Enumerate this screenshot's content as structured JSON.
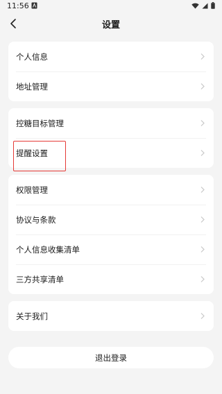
{
  "status_bar": {
    "time": "11:56",
    "icons": [
      "notification-icon",
      "wifi-icon",
      "signal-icon",
      "battery-icon"
    ]
  },
  "header": {
    "title": "设置",
    "back_icon": "chevron-left-icon"
  },
  "groups": [
    {
      "items": [
        {
          "label": "个人信息"
        },
        {
          "label": "地址管理"
        }
      ]
    },
    {
      "items": [
        {
          "label": "控糖目标管理"
        },
        {
          "label": "提醒设置"
        }
      ]
    },
    {
      "items": [
        {
          "label": "权限管理"
        },
        {
          "label": "协议与条款"
        },
        {
          "label": "个人信息收集清单"
        },
        {
          "label": "三方共享清单"
        }
      ]
    },
    {
      "items": [
        {
          "label": "关于我们"
        }
      ]
    }
  ],
  "highlighted_item": "提醒设置",
  "logout_label": "退出登录",
  "colors": {
    "background": "#f4f4f4",
    "card": "#ffffff",
    "highlight_border": "#e53935",
    "chevron": "#c8c8c8"
  }
}
